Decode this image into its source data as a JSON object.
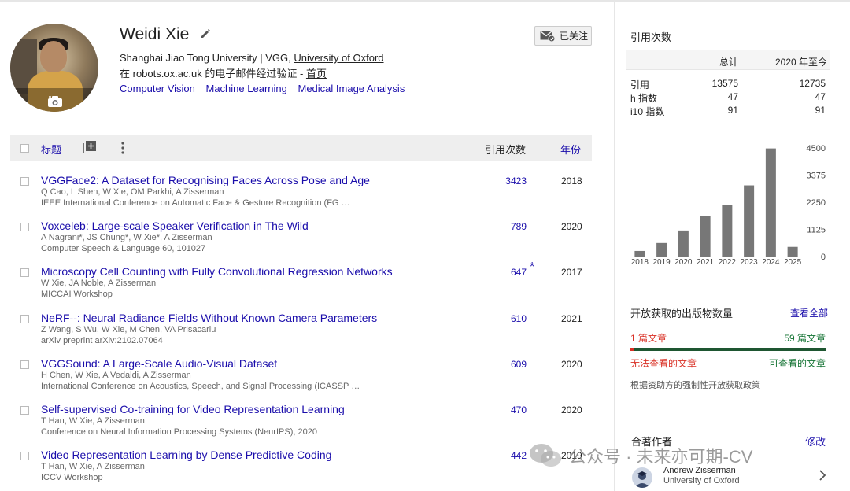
{
  "profile": {
    "name": "Weidi Xie",
    "affiliation_prefix": "Shanghai Jiao Tong University | VGG, ",
    "affiliation_link": "University of Oxford",
    "verify_prefix": "在 robots.ox.ac.uk 的电子邮件经过验证 - ",
    "homepage_link": "首页",
    "interests": [
      "Computer Vision",
      "Machine Learning",
      "Medical Image Analysis"
    ],
    "follow_label": "已关注"
  },
  "table": {
    "title_header": "标题",
    "cited_header": "引用次数",
    "year_header": "年份",
    "rows": [
      {
        "title": "VGGFace2: A Dataset for Recognising Faces Across Pose and Age",
        "authors": "Q Cao, L Shen, W Xie, OM Parkhi, A Zisserman",
        "venue": "IEEE International Conference on Automatic Face & Gesture Recognition (FG …",
        "cited": "3423",
        "year": "2018",
        "star": ""
      },
      {
        "title": "Voxceleb: Large-scale Speaker Verification in The Wild",
        "authors": "A Nagrani*, JS Chung*, W Xie*, A Zisserman",
        "venue": "Computer Speech & Language 60, 101027",
        "cited": "789",
        "year": "2020",
        "star": ""
      },
      {
        "title": "Microscopy Cell Counting with Fully Convolutional Regression Networks",
        "authors": "W Xie, JA Noble, A Zisserman",
        "venue": "MICCAI Workshop",
        "cited": "647",
        "year": "2017",
        "star": "*"
      },
      {
        "title": "NeRF--: Neural Radiance Fields Without Known Camera Parameters",
        "authors": "Z Wang, S Wu, W Xie, M Chen, VA Prisacariu",
        "venue": "arXiv preprint arXiv:2102.07064",
        "cited": "610",
        "year": "2021",
        "star": ""
      },
      {
        "title": "VGGSound: A Large-Scale Audio-Visual Dataset",
        "authors": "H Chen, W Xie, A Vedaldi, A Zisserman",
        "venue": "International Conference on Acoustics, Speech, and Signal Processing (ICASSP …",
        "cited": "609",
        "year": "2020",
        "star": ""
      },
      {
        "title": "Self-supervised Co-training for Video Representation Learning",
        "authors": "T Han, W Xie, A Zisserman",
        "venue": "Conference on Neural Information Processing Systems (NeurIPS), 2020",
        "cited": "470",
        "year": "2020",
        "star": ""
      },
      {
        "title": "Video Representation Learning by Dense Predictive Coding",
        "authors": "T Han, W Xie, A Zisserman",
        "venue": "ICCV Workshop",
        "cited": "442",
        "year": "2019",
        "star": ""
      }
    ]
  },
  "citations": {
    "title": "引用次数",
    "col_all": "总计",
    "col_recent": "2020 年至今",
    "rows": [
      {
        "label": "引用",
        "all": "13575",
        "recent": "12735"
      },
      {
        "label": "h 指数",
        "all": "47",
        "recent": "47"
      },
      {
        "label": "i10 指数",
        "all": "91",
        "recent": "91"
      }
    ]
  },
  "chart_data": {
    "type": "bar",
    "categories": [
      "2018",
      "2019",
      "2020",
      "2021",
      "2022",
      "2023",
      "2024",
      "2025"
    ],
    "values": [
      230,
      560,
      1080,
      1690,
      2140,
      2950,
      4480,
      400
    ],
    "yticks": [
      "4500",
      "3375",
      "2250",
      "1125",
      "0"
    ],
    "ylim": [
      0,
      4500
    ],
    "bar_color": "#777777"
  },
  "open_access": {
    "title": "开放获取的出版物数量",
    "view_all": "查看全部",
    "unavailable_count": "1 篇文章",
    "available_count": "59 篇文章",
    "unavailable_label": "无法查看的文章",
    "available_label": "可查看的文章",
    "note": "根据资助方的强制性开放获取政策",
    "fraction_available": 0.983
  },
  "coauthors": {
    "title": "合著作者",
    "edit": "修改",
    "list": [
      {
        "name": "Andrew Zisserman",
        "affiliation": "University of Oxford"
      }
    ]
  },
  "watermark": {
    "text": "公众号 · 未来亦可期-CV"
  }
}
